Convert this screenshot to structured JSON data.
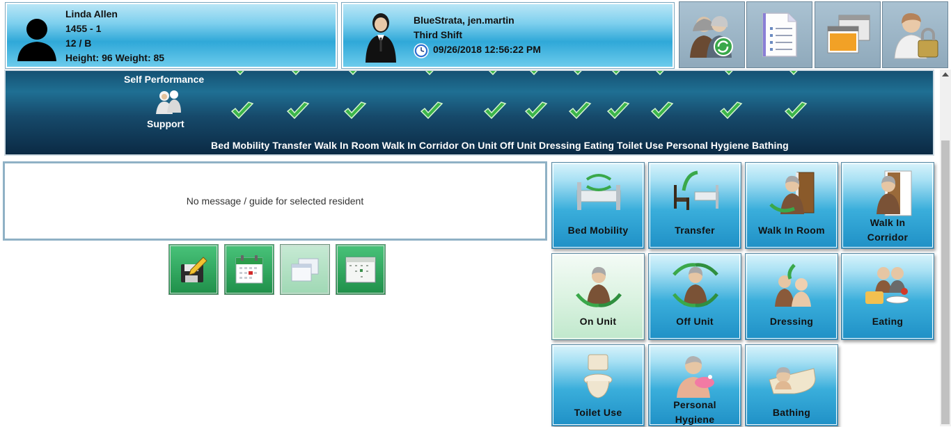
{
  "resident": {
    "name": "Linda Allen",
    "id": "1455 - 1",
    "room": "12 / B",
    "measurements": "Height: 96 Weight: 85",
    "icon": "person-silhouette-icon"
  },
  "staff": {
    "name": "BlueStrata, jen.martin",
    "shift": "Third Shift",
    "datetime": "09/26/2018 12:56:22 PM",
    "icon": "staff-business-icon",
    "clock_icon": "clock-icon"
  },
  "toolbar": {
    "buttons": [
      {
        "icon": "switch-resident-icon"
      },
      {
        "icon": "document-list-icon"
      },
      {
        "icon": "windows-icon"
      },
      {
        "icon": "user-lock-icon"
      }
    ]
  },
  "performance": {
    "self_performance_label": "Self Performance",
    "support_label": "Support",
    "categories": [
      "Bed Mobility",
      "Transfer",
      "Walk In Room",
      "Walk In Corridor",
      "On Unit",
      "Off Unit",
      "Dressing",
      "Eating",
      "Toilet Use",
      "Personal Hygiene",
      "Bathing"
    ],
    "category_line": "Bed Mobility Transfer Walk In Room Walk In Corridor On Unit Off Unit Dressing Eating Toilet Use Personal Hygiene Bathing",
    "check_color": "#3cb54a"
  },
  "message": {
    "text": "No message / guide for selected resident"
  },
  "actions": [
    {
      "icon": "save-edit-icon",
      "enabled": true
    },
    {
      "icon": "calendar-icon",
      "enabled": true
    },
    {
      "icon": "windows-icon",
      "enabled": false
    },
    {
      "icon": "schedule-grid-icon",
      "enabled": true
    }
  ],
  "tiles": [
    {
      "label": "Bed Mobility",
      "selected": false,
      "icon": "bed-mobility-icon"
    },
    {
      "label": "Transfer",
      "selected": false,
      "icon": "transfer-icon"
    },
    {
      "label": "Walk In Room",
      "selected": false,
      "icon": "walk-in-room-icon"
    },
    {
      "label": "Walk In Corridor",
      "selected": false,
      "icon": "walk-in-corridor-icon"
    },
    {
      "label": "On Unit",
      "selected": true,
      "icon": "on-unit-icon"
    },
    {
      "label": "Off Unit",
      "selected": false,
      "icon": "off-unit-icon"
    },
    {
      "label": "Dressing",
      "selected": false,
      "icon": "dressing-icon"
    },
    {
      "label": "Eating",
      "selected": false,
      "icon": "eating-icon"
    },
    {
      "label": "Toilet Use",
      "selected": false,
      "icon": "toilet-icon"
    },
    {
      "label": "Personal Hygiene",
      "selected": false,
      "icon": "personal-hygiene-icon"
    },
    {
      "label": "Bathing",
      "selected": false,
      "icon": "bathing-icon"
    }
  ],
  "colors": {
    "header_blue": "#2fa8d8",
    "band_dark": "#0b2a44",
    "action_green": "#1f8f49",
    "selected_tile": "#dcf3e2"
  }
}
